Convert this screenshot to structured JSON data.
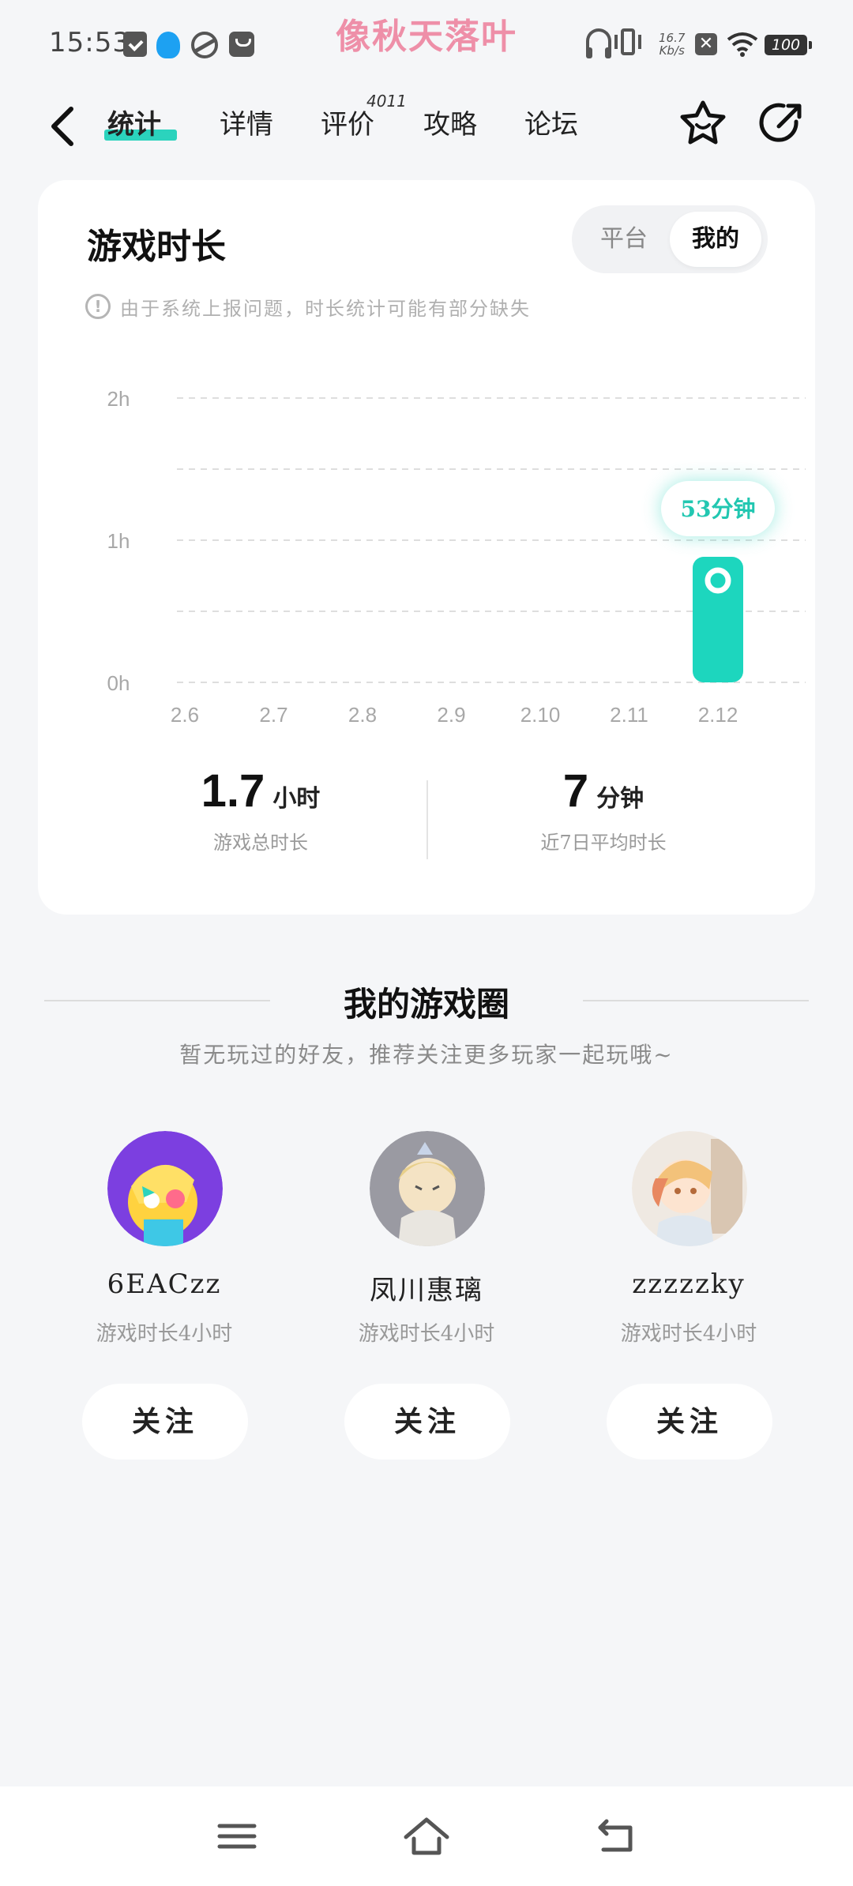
{
  "status_bar": {
    "time": "15:53",
    "watermark": "像秋天落叶",
    "speed_value": "16.7",
    "speed_unit": "Kb/s",
    "battery": "100"
  },
  "nav": {
    "tabs": [
      {
        "label": "统计",
        "active": true
      },
      {
        "label": "详情"
      },
      {
        "label": "评价",
        "badge": "4011"
      },
      {
        "label": "攻略"
      },
      {
        "label": "论坛"
      }
    ],
    "accent_color": "#2bd3bd"
  },
  "stats": {
    "title": "游戏时长",
    "segment": {
      "options": [
        "平台",
        "我的"
      ],
      "selected": "我的"
    },
    "notice": "由于系统上报问题，时长统计可能有部分缺失",
    "summary": {
      "total_value": "1.7",
      "total_unit": "小时",
      "total_label": "游戏总时长",
      "avg_value": "7",
      "avg_unit": "分钟",
      "avg_label": "近7日平均时长"
    }
  },
  "chart_data": {
    "type": "bar",
    "categories": [
      "2.6",
      "2.7",
      "2.8",
      "2.9",
      "2.10",
      "2.11",
      "2.12"
    ],
    "values": [
      0,
      0,
      0,
      0,
      0,
      0,
      53
    ],
    "value_unit": "minutes",
    "highlight_label": "53分钟",
    "y_ticks": [
      "0h",
      "1h",
      "2h"
    ],
    "ylim": [
      0,
      120
    ],
    "grid": true,
    "bar_color": "#1dd6be"
  },
  "circle": {
    "title": "我的游戏圈",
    "subtitle": "暂无玩过的好友，推荐关注更多玩家一起玩哦~",
    "friends": [
      {
        "name": "6EACzz",
        "time": "游戏时长4小时",
        "follow": "关注"
      },
      {
        "name": "凤川惠璃",
        "time": "游戏时长4小时",
        "follow": "关注"
      },
      {
        "name": "zzzzzky",
        "time": "游戏时长4小时",
        "follow": "关注"
      }
    ]
  }
}
